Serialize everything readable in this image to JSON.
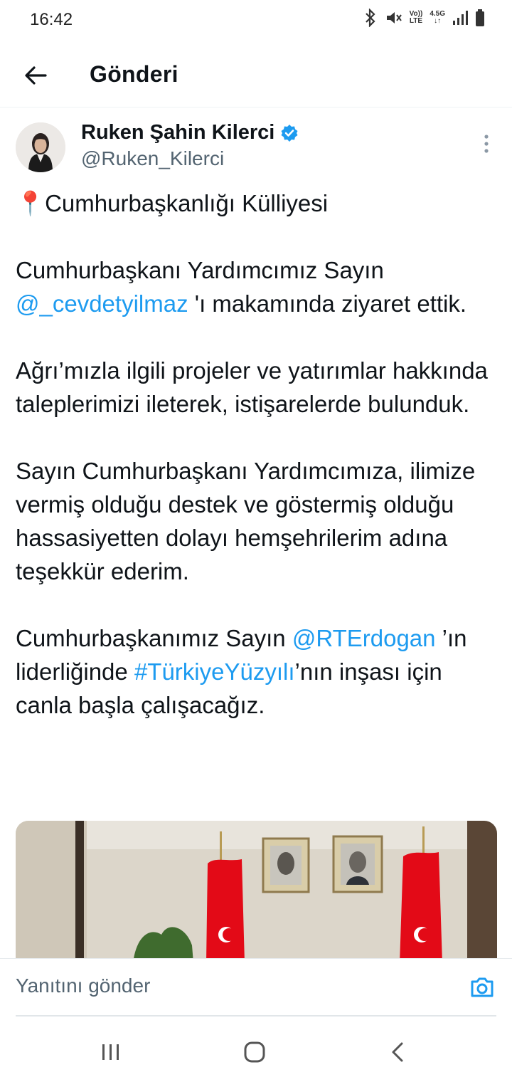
{
  "status_bar": {
    "time": "16:42",
    "volte": "Vo))",
    "lte": "LTE",
    "net": "4.5G"
  },
  "header": {
    "title": "Gönderi"
  },
  "author": {
    "name": "Ruken Şahin Kilerci",
    "handle": "@Ruken_Kilerci"
  },
  "tweet": {
    "line1_emoji": "📍",
    "line1_text": "Cumhurbaşkanlığı Külliyesi",
    "p1_a": "Cumhurbaşkanı Yardımcımız Sayın ",
    "p1_mention": "@_cevdetyilmaz",
    "p1_b": " 'ı makamında ziyaret ettik.",
    "p2": "Ağrı’mızla ilgili projeler ve yatırımlar hakkında taleplerimizi ileterek, istişarelerde bulunduk.",
    "p3": "Sayın Cumhurbaşkanı Yardımcımıza, ilimize vermiş olduğu destek ve göstermiş olduğu hassasiyetten dolayı hemşehrilerim adına teşekkür ederim.",
    "p4_a": "Cumhurbaşkanımız Sayın ",
    "p4_mention": "@RTErdogan",
    "p4_b": " ’ın liderliğinde ",
    "p4_hashtag": "#TürkiyeYüzyılı",
    "p4_c": "’nın inşası için canla başla çalışacağız."
  },
  "reply": {
    "placeholder": "Yanıtını gönder"
  },
  "colors": {
    "accent": "#1d9bf0",
    "text": "#0f1419",
    "secondary": "#536471",
    "verified": "#1d9bf0",
    "flag_red": "#e30a17"
  },
  "icons": {
    "back": "arrow-left-icon",
    "verified": "verified-badge-icon",
    "more": "more-vertical-icon",
    "camera": "camera-icon",
    "location": "round-pushpin-emoji"
  }
}
